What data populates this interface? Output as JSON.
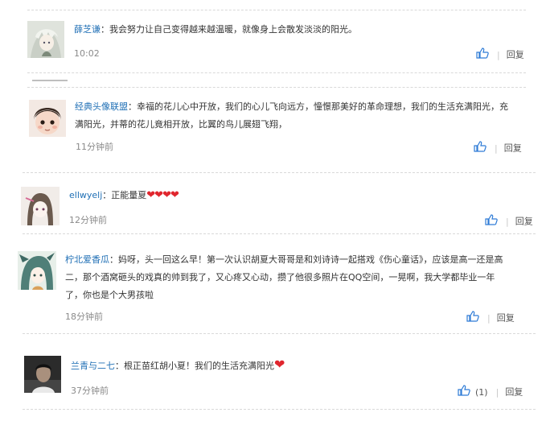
{
  "comments": [
    {
      "username": "薛芝谦",
      "text": "我会努力让自己变得越来越温暖，就像身上会散发淡淡的阳光。",
      "time": "10:02",
      "reply_label": "回复",
      "avatar_icon": "anime-girl-white-hair-avatar"
    },
    {
      "username": "经典头像联盟",
      "text": "幸福的花儿心中开放，我们的心儿飞向远方，憧憬那美好的革命理想，我们的生活充满阳光，充满阳光，并蒂的花儿竟相开放，比翼的鸟儿展翅飞翔，",
      "time": "11分钟前",
      "reply_label": "回复",
      "avatar_icon": "baby-face-avatar"
    },
    {
      "username": "ellwyelj",
      "text": "正能量夏",
      "hearts": "❤❤❤❤",
      "time": "12分钟前",
      "reply_label": "回复",
      "avatar_icon": "anime-girl-sketch-avatar"
    },
    {
      "username": "柠北爱香瓜",
      "text": "妈呀，头一回这么早！第一次认识胡夏大哥哥是和刘诗诗一起搭戏《伤心童话》，应该是高一还是高二，那个酒窝砸头的戏真的帅到我了，又心疼又心动，攒了他很多照片在QQ空间，一晃啊，我大学都毕业一年了，你也是个大男孩啦",
      "time": "18分钟前",
      "reply_label": "回复",
      "avatar_icon": "anime-girl-teal-hair-avatar"
    },
    {
      "username": "兰青与二七",
      "text": "根正苗红胡小夏！我们的生活充满阳光",
      "hearts": "❤",
      "time": "37分钟前",
      "like_count": "(1)",
      "reply_label": "回复",
      "avatar_icon": "dark-photo-avatar"
    }
  ],
  "colon": "：",
  "pipe": "|",
  "colors": {
    "username": "#1f6fb5",
    "like_icon": "#2e7bd6",
    "heart": "#e0262e",
    "divider": "#d9d9d9",
    "time": "#8a8a8a"
  }
}
